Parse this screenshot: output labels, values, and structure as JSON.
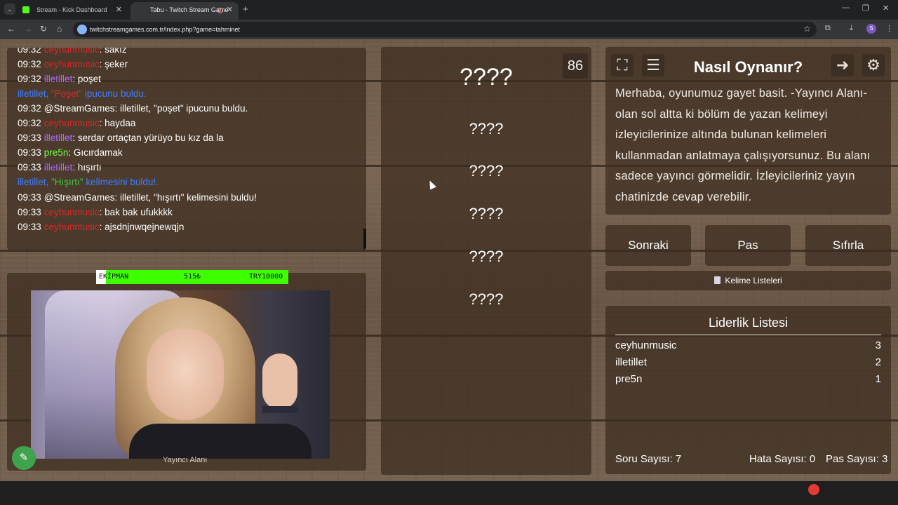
{
  "browser": {
    "tabs": [
      {
        "title": "Stream - Kick Dashboard"
      },
      {
        "title": "Tabu - Twitch Stream Game"
      }
    ],
    "url": "twitchstreamgames.com.tr/index.php?game=tahminet",
    "profile_initial": "S"
  },
  "chat": {
    "lines": [
      {
        "time": "09:32",
        "user": "ceyhunmusic",
        "msg": ": sakız"
      },
      {
        "time": "09:32",
        "user": "ceyhunmusic",
        "msg": ": şeker"
      },
      {
        "time": "09:32",
        "user": "illetillet",
        "msg": ": poşet"
      },
      {
        "system": "illetillet, ",
        "quote": "\"Poşet\"",
        "rest": " ipucunu buldu."
      },
      {
        "time": "09:32",
        "user": "@StreamGames",
        "msg": ": illetillet, \"poşet\" ipucunu buldu."
      },
      {
        "time": "09:32",
        "user": "ceyhunmusic",
        "msg": ": haydaa"
      },
      {
        "time": "09:33",
        "user": "illetillet",
        "msg": ": serdar ortaçtan yürüyo bu kız da la"
      },
      {
        "time": "09:33",
        "user": "pre5n",
        "msg": ": Gıcırdamak"
      },
      {
        "time": "09:33",
        "user": "illetillet",
        "msg": ": hışırtı"
      },
      {
        "system": "illetillet, ",
        "quote": "\"Hışırtı\"",
        "rest": " kelimesini buldu!."
      },
      {
        "time": "09:33",
        "user": "@StreamGames",
        "msg": ": illetillet, \"hışırtı\" kelimesini buldu!"
      },
      {
        "time": "09:33",
        "user": "ceyhunmusic",
        "msg": ": bak bak ufukkkk"
      },
      {
        "time": "09:33",
        "user": "ceyhunmusic",
        "msg": ": ajsdnjnwqejnewqjn"
      }
    ]
  },
  "donation": {
    "label": "EKİPMAN",
    "amount": "515₺",
    "target": "TRY10000"
  },
  "streamer_label": "Yayıncı Alanı",
  "game": {
    "timer": "86",
    "main_word": "????",
    "hints": [
      "????",
      "????",
      "????",
      "????",
      "????"
    ]
  },
  "howto": {
    "title": "Nasıl Oynanır?",
    "text": "Merhaba, oyunumuz gayet basit. -Yayıncı Alanı- olan sol altta ki bölüm de yazan kelimeyi izleyicilerinize altında bulunan kelimeleri kullanmadan anlatmaya çalışıyorsunuz. Bu alanı sadece yayıncı görmelidir. İzleyicileriniz yayın chatinizde cevap verebilir."
  },
  "buttons": {
    "next": "Sonraki",
    "pass": "Pas",
    "reset": "Sıfırla"
  },
  "wordlists_label": "Kelime Listeleri",
  "leaderboard": {
    "title": "Liderlik Listesi",
    "rows": [
      {
        "name": "ceyhunmusic",
        "score": "3"
      },
      {
        "name": "illetillet",
        "score": "2"
      },
      {
        "name": "pre5n",
        "score": "1"
      }
    ],
    "stats": {
      "questions": "Soru Sayısı: 7",
      "errors": "Hata Sayısı: 0",
      "passes": "Pas Sayısı: 3"
    }
  },
  "colors": {
    "user_red": "#e02525",
    "user_purple": "#b36bff",
    "user_green": "#6cff3a",
    "system_blue": "#3d7dff",
    "donation_green": "#3dff00"
  }
}
